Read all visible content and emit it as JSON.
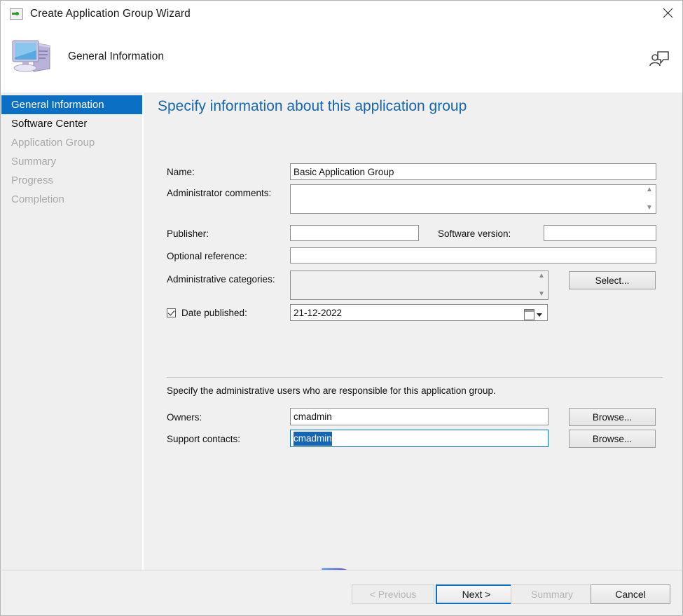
{
  "window": {
    "title": "Create Application Group Wizard",
    "title_icon": "console-icon",
    "close_icon": "close-icon"
  },
  "header": {
    "icon": "computer-icon",
    "title": "General Information",
    "feedback_icon": "feedback-person-icon"
  },
  "sidebar": {
    "items": [
      {
        "label": "General Information",
        "state": "selected"
      },
      {
        "label": "Software Center",
        "state": "done"
      },
      {
        "label": "Application Group",
        "state": "pending"
      },
      {
        "label": "Summary",
        "state": "pending"
      },
      {
        "label": "Progress",
        "state": "pending"
      },
      {
        "label": "Completion",
        "state": "pending"
      }
    ]
  },
  "content": {
    "heading": "Specify information about this application group",
    "fields": {
      "name_label": "Name:",
      "name_value": "Basic Application Group",
      "comments_label": "Administrator comments:",
      "comments_value": "",
      "publisher_label": "Publisher:",
      "publisher_value": "",
      "software_version_label": "Software version:",
      "software_version_value": "",
      "optional_reference_label": "Optional reference:",
      "optional_reference_value": "",
      "admin_categories_label": "Administrative categories:",
      "admin_categories_value": "",
      "select_button": "Select...",
      "date_published_label": "Date published:",
      "date_published_value": "21-12-2022",
      "date_published_checked": true,
      "calendar_icon": "calendar-icon",
      "dropdown_icon": "chevron-down-icon"
    },
    "admin_section": {
      "note": "Specify the administrative users who are responsible for this application group.",
      "owners_label": "Owners:",
      "owners_value": "cmadmin",
      "owners_browse": "Browse...",
      "support_label": "Support contacts:",
      "support_value": "cmadmin",
      "support_browse": "Browse...",
      "support_selected": true
    }
  },
  "footer": {
    "previous": "< Previous",
    "previous_enabled": false,
    "next": "Next >",
    "next_default": true,
    "summary": "Summary",
    "summary_enabled": false,
    "cancel": "Cancel"
  },
  "watermark": {
    "letter": "P"
  },
  "colors": {
    "accent": "#0b6fc4",
    "heading": "#1667b0",
    "panel": "#f0f0f0",
    "selection": "#1564b5"
  }
}
